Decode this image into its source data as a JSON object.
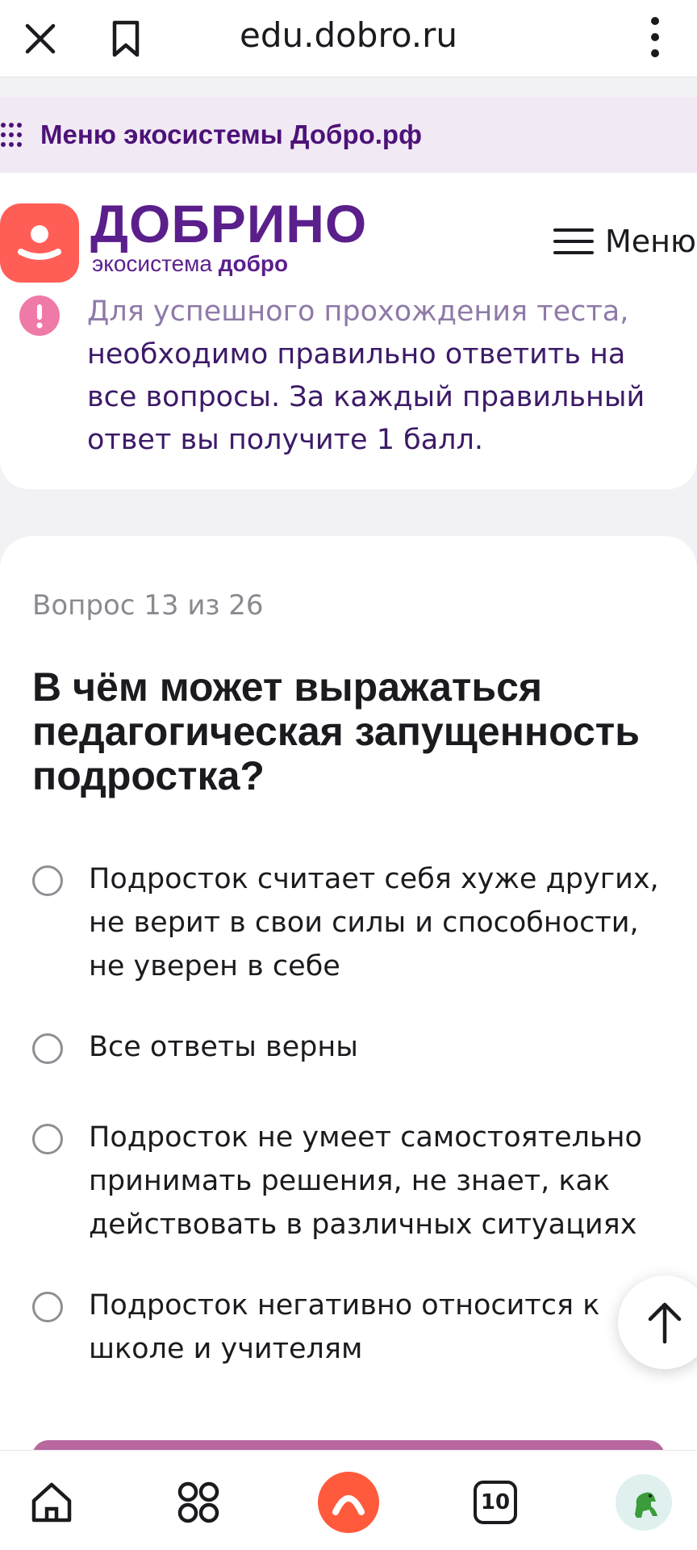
{
  "browser": {
    "url": "edu.dobro.ru"
  },
  "eco_menu": {
    "label": "Меню экосистемы Добро.рф"
  },
  "header": {
    "logo_title": "ДОБРИНО",
    "logo_sub_prefix": "экосистема",
    "logo_sub_brand": "добро",
    "menu_label": "Меню"
  },
  "notice": {
    "line1": "Для успешного прохождения теста,",
    "rest": "необходимо правильно ответить на все вопросы. За каждый правильный ответ вы получите 1 балл."
  },
  "question": {
    "counter": "Вопрос 13 из 26",
    "title": "В чём может выражаться педагогическая запущенность подростка?",
    "options": [
      {
        "label": "Подросток считает себя хуже других, не верит в свои силы и способности, не уверен в себе",
        "selected": false
      },
      {
        "label": "Все ответы верны",
        "selected": false
      },
      {
        "label": "Подросток не умеет самостоятельно принимать решения, не знает, как действовать в различных ситуациях",
        "selected": false
      },
      {
        "label": "Подросток негативно относится к школе и учителям",
        "selected": false
      }
    ]
  },
  "bottom_nav": {
    "tabs_count": "10"
  },
  "colors": {
    "brand_purple": "#5b1f8c",
    "brand_red": "#ff5e57",
    "alert_pink": "#ef7aa7"
  }
}
